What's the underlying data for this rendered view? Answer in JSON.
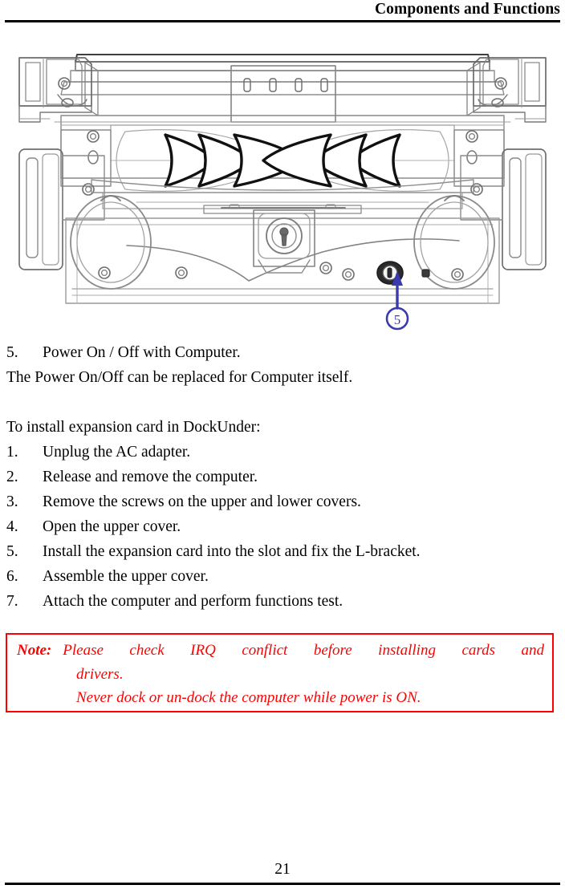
{
  "header": {
    "title": "Components and Functions"
  },
  "figure": {
    "caption_marker": "5",
    "callout_color": "#3b3bb0",
    "line_color": "#4a4a4a",
    "description": "docking-station-rear-view-line-drawing"
  },
  "body": {
    "item5": {
      "num": "5.",
      "text": "Power On / Off with Computer."
    },
    "paragraph1": "The Power On/Off can be replaced for Computer itself.",
    "intro": "To install expansion card in DockUnder:",
    "steps": [
      {
        "num": "1.",
        "text": "Unplug the AC adapter."
      },
      {
        "num": "2.",
        "text": "Release and remove the computer."
      },
      {
        "num": "3.",
        "text": "Remove the screws on the upper and lower covers."
      },
      {
        "num": "4.",
        "text": "Open the upper cover."
      },
      {
        "num": "5.",
        "text": "Install the expansion card into the slot and fix the L-bracket."
      },
      {
        "num": "6.",
        "text": "Assemble the upper cover."
      },
      {
        "num": "7.",
        "text": "Attach the computer and perform functions test."
      }
    ]
  },
  "note": {
    "label": "Note:",
    "line1": "Please check IRQ conflict before installing cards and",
    "line2": "drivers.",
    "line3": "Never dock or un-dock the computer while power is ON.",
    "color": "#ff0000"
  },
  "footer": {
    "page_number": "21"
  }
}
